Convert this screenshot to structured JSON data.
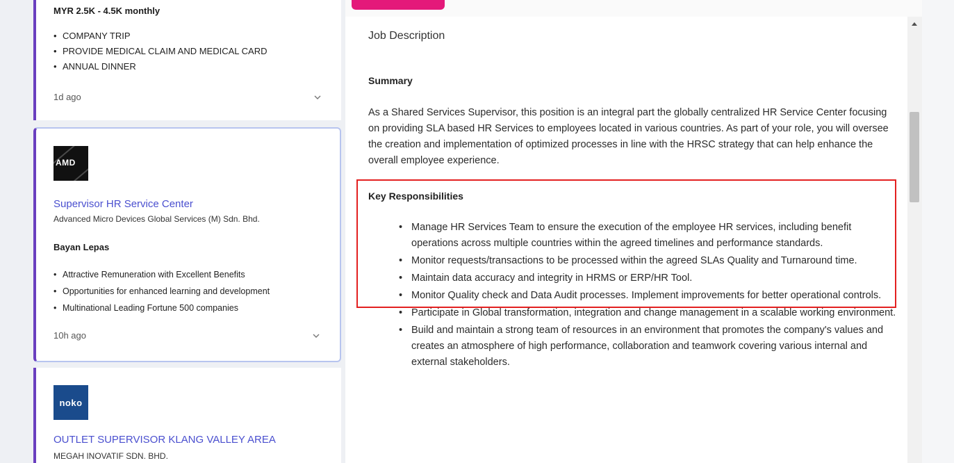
{
  "left_list": {
    "card1": {
      "salary": "MYR 2.5K - 4.5K monthly",
      "benefits": [
        "COMPANY TRIP",
        "PROVIDE MEDICAL CLAIM AND MEDICAL CARD",
        "ANNUAL DINNER"
      ],
      "posted": "1d ago"
    },
    "card2": {
      "logo_text": "AMD",
      "title": "Supervisor HR Service Center",
      "company": "Advanced Micro Devices Global Services (M) Sdn. Bhd.",
      "location": "Bayan Lepas",
      "benefits": [
        "Attractive Remuneration with Excellent Benefits",
        "Opportunities for enhanced learning and development",
        "Multinational Leading Fortune 500 companies"
      ],
      "posted": "10h ago"
    },
    "card3": {
      "logo_text": "noko",
      "title": "OUTLET SUPERVISOR KLANG VALLEY AREA",
      "company": "MEGAH INOVATIF SDN. BHD."
    }
  },
  "detail": {
    "heading": "Job Description",
    "summary_title": "Summary",
    "summary_text": "As a Shared Services Supervisor, this position is an integral part the globally centralized HR Service Center focusing on providing SLA based HR Services to employees located in various countries. As part of your role, you will oversee the creation and implementation of optimized processes in line with the HRSC strategy that can help enhance the overall employee experience.",
    "responsibilities_title": "Key Responsibilities",
    "responsibilities": [
      "Manage HR Services Team to ensure the execution of the employee HR services, including benefit operations across multiple countries within the agreed timelines and performance standards.",
      "Monitor requests/transactions to be processed within the agreed SLAs Quality and Turnaround time.",
      "Maintain data accuracy and integrity in HRMS or ERP/HR Tool.",
      "Monitor Quality check and Data Audit processes. Implement improvements for better operational controls.",
      "Participate in Global transformation, integration and change management in a scalable working environment.",
      "Build and maintain a strong team of resources in an environment that promotes the company's values and creates an atmosphere of high performance, collaboration and teamwork covering various internal and external stakeholders."
    ]
  },
  "colors": {
    "accent_purple": "#6a3fbf",
    "link_blue": "#4a4fcf",
    "pink_tab": "#e4197a",
    "highlight_red": "#e32020"
  }
}
